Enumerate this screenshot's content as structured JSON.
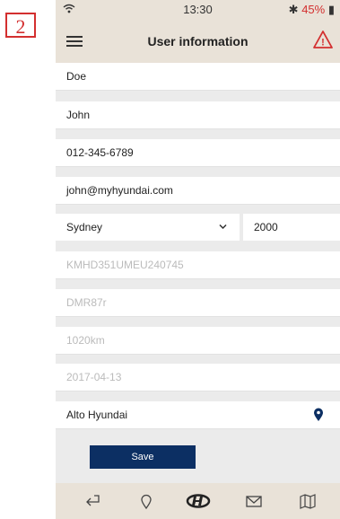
{
  "annotation": {
    "step_number": "2"
  },
  "status_bar": {
    "time": "13:30",
    "battery_percent": "45%",
    "bluetooth_symbol": "✱"
  },
  "header": {
    "title": "User information",
    "alert_mark": "!"
  },
  "form": {
    "last_name": "Doe",
    "first_name": "John",
    "phone": "012-345-6789",
    "email": "john@myhyundai.com",
    "city": "Sydney",
    "postcode": "2000",
    "vin": "KMHD351UMEU240745",
    "registration": "DMR87r",
    "odometer": "1020km",
    "date": "2017-04-13",
    "dealer": "Alto Hyundai"
  },
  "save_label": "Save",
  "colors": {
    "header_bg": "#e9e2d8",
    "save_bg": "#0c2f63",
    "pin": "#0c2f63",
    "warning": "#d32f2f"
  },
  "tabbar": {
    "icons": [
      "back-arrow-icon",
      "location-pin-outline-icon",
      "hyundai-logo-icon",
      "mail-icon",
      "map-icon"
    ]
  }
}
